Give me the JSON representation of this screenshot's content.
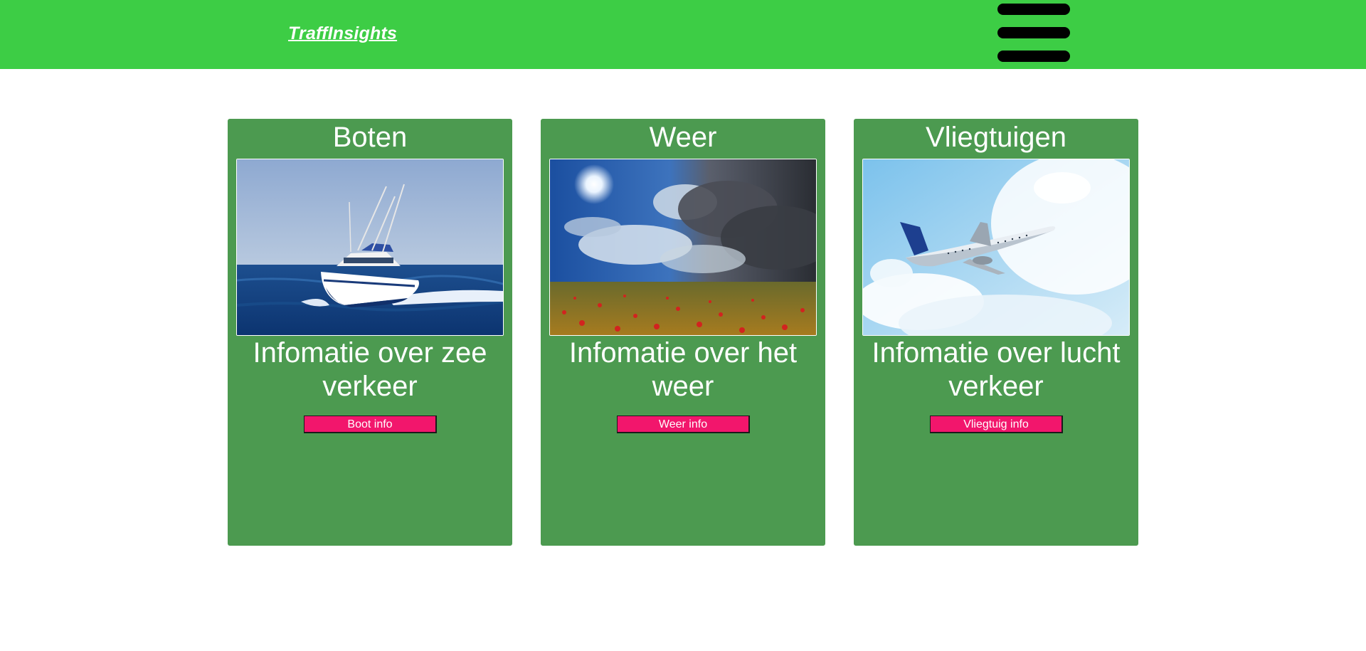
{
  "header": {
    "logo_part1": "Traff",
    "logo_part2": "Insights",
    "menu_icon": "hamburger-icon",
    "background": "#3dcd45"
  },
  "cards": [
    {
      "title": "Boten",
      "image": "motorboat-photo",
      "description": "Infomatie over zee verkeer",
      "button": "Boot info"
    },
    {
      "title": "Weer",
      "image": "weather-sky-field-photo",
      "description": "Infomatie over het weer",
      "button": "Weer info"
    },
    {
      "title": "Vliegtuigen",
      "image": "airplane-photo",
      "description": "Infomatie over lucht verkeer",
      "button": "Vliegtuig info"
    }
  ],
  "colors": {
    "card": "#4c9a50",
    "button": "#f2166c"
  }
}
